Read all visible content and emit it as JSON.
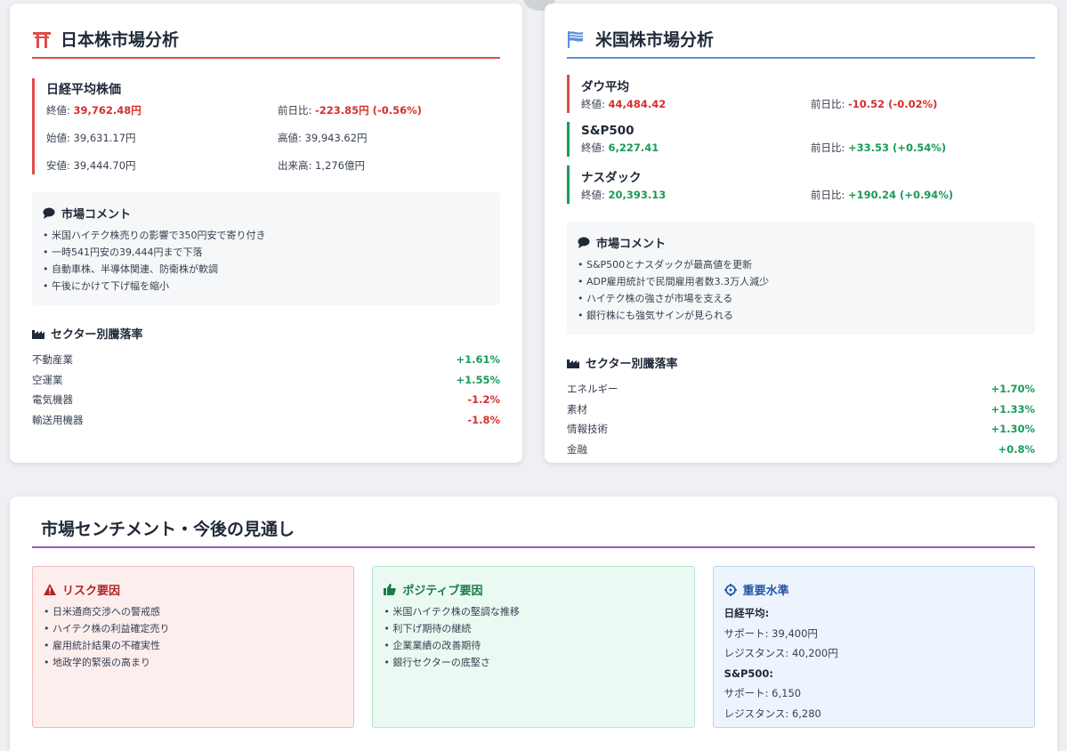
{
  "japan": {
    "title": "日本株市場分析",
    "index_name": "日経平均株価",
    "close_label": "終値: ",
    "close_value": "39,762.48円",
    "change_label": "前日比: ",
    "change_value": "-223.85円 (-0.56%)",
    "open": "始値: 39,631.17円",
    "high": "高値: 39,943.62円",
    "low": "安値: 39,444.70円",
    "volume": "出来高: 1,276億円",
    "comment_title": "市場コメント",
    "comments": [
      "• 米国ハイテク株売りの影響で350円安で寄り付き",
      "• 一時541円安の39,444円まで下落",
      "• 自動車株、半導体関連、防衛株が軟調",
      "• 午後にかけて下げ幅を縮小"
    ],
    "sector_title": "セクター別騰落率",
    "sectors": [
      {
        "name": "不動産業",
        "value": "+1.61%",
        "dir": "up"
      },
      {
        "name": "空運業",
        "value": "+1.55%",
        "dir": "up"
      },
      {
        "name": "電気機器",
        "value": "-1.2%",
        "dir": "down"
      },
      {
        "name": "輸送用機器",
        "value": "-1.8%",
        "dir": "down"
      }
    ]
  },
  "us": {
    "title": "米国株市場分析",
    "indices": [
      {
        "name": "ダウ平均",
        "close_label": "終値: ",
        "close_value": "44,484.42",
        "change_label": "前日比: ",
        "change_value": "-10.52 (-0.02%)",
        "dir": "down"
      },
      {
        "name": "S&P500",
        "close_label": "終値: ",
        "close_value": "6,227.41",
        "change_label": "前日比: ",
        "change_value": "+33.53 (+0.54%)",
        "dir": "up"
      },
      {
        "name": "ナスダック",
        "close_label": "終値: ",
        "close_value": "20,393.13",
        "change_label": "前日比: ",
        "change_value": "+190.24 (+0.94%)",
        "dir": "up"
      }
    ],
    "comment_title": "市場コメント",
    "comments": [
      "• S&P500とナスダックが最高値を更新",
      "• ADP雇用統計で民間雇用者数3.3万人減少",
      "• ハイテク株の強さが市場を支える",
      "• 銀行株にも強気サインが見られる"
    ],
    "sector_title": "セクター別騰落率",
    "sectors": [
      {
        "name": "エネルギー",
        "value": "+1.70%",
        "dir": "up"
      },
      {
        "name": "素材",
        "value": "+1.33%",
        "dir": "up"
      },
      {
        "name": "情報技術",
        "value": "+1.30%",
        "dir": "up"
      },
      {
        "name": "金融",
        "value": "+0.8%",
        "dir": "up"
      }
    ]
  },
  "outlook": {
    "title": "市場センチメント・今後の見通し",
    "risk": {
      "title": "リスク要因",
      "items": [
        "• 日米通商交渉への警戒感",
        "• ハイテク株の利益確定売り",
        "• 雇用統計結果の不確実性",
        "• 地政学的緊張の高まり"
      ]
    },
    "positive": {
      "title": "ポジティブ要因",
      "items": [
        "• 米国ハイテク株の堅調な推移",
        "• 利下げ期待の継続",
        "• 企業業績の改善期待",
        "• 銀行セクターの底堅さ"
      ]
    },
    "key_levels": {
      "title": "重要水準",
      "nikkei_label": "日経平均:",
      "nikkei_support": "サポート: 39,400円",
      "nikkei_resistance": "レジスタンス: 40,200円",
      "sp_label": "S&P500:",
      "sp_support": "サポート: 6,150",
      "sp_resistance": "レジスタンス: 6,280"
    }
  },
  "colors": {
    "up": "#1a9a5a",
    "down": "#d92d2d",
    "jp_accent": "#e04b4b",
    "us_accent": "#5b8fd8",
    "outlook_accent": "#9b59b6"
  },
  "icons": {
    "jp": "torii-icon",
    "us": "flag-icon",
    "comment": "speech-bubble-icon",
    "sector": "factory-icon",
    "risk": "warning-icon",
    "positive": "thumbs-up-icon",
    "key": "crosshair-icon"
  }
}
